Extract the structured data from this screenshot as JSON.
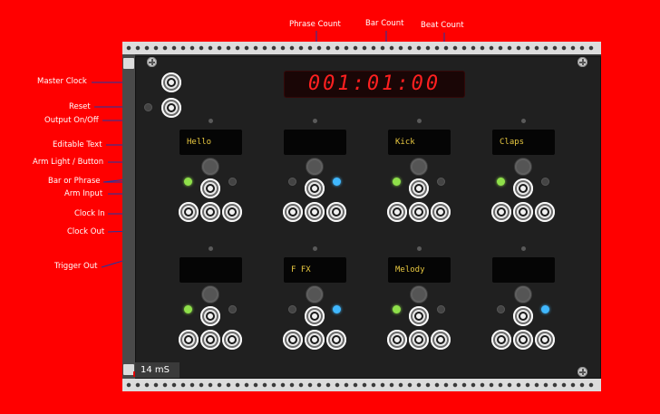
{
  "annotations": {
    "phrase_count": "Phrase Count",
    "bar_count": "Bar Count",
    "beat_count": "Beat Count",
    "master_clock": "Master Clock",
    "reset": "Reset",
    "output_on_off": "Output On/Off",
    "editable_text": "Editable Text",
    "arm_light_button": "Arm Light / Button",
    "bar_or_phrase": "Bar or Phrase",
    "arm_input": "Arm Input",
    "clock_in": "Clock In",
    "clock_out": "Clock Out",
    "trigger_out": "Trigger Out"
  },
  "counter_display": "001:01:00",
  "latency": "14 mS",
  "tracks": [
    {
      "text": "Hello",
      "bar_or_phrase_light": "green",
      "arm_light": "off"
    },
    {
      "text": "",
      "bar_or_phrase_light": "off",
      "arm_light": "blue"
    },
    {
      "text": "Kick",
      "bar_or_phrase_light": "green",
      "arm_light": "off"
    },
    {
      "text": "Claps",
      "bar_or_phrase_light": "green",
      "arm_light": "off"
    },
    {
      "text": "",
      "bar_or_phrase_light": "green",
      "arm_light": "off"
    },
    {
      "text": "F FX",
      "bar_or_phrase_light": "off",
      "arm_light": "blue"
    },
    {
      "text": "Melody",
      "bar_or_phrase_light": "green",
      "arm_light": "off"
    },
    {
      "text": "",
      "bar_or_phrase_light": "off",
      "arm_light": "blue"
    }
  ],
  "colors": {
    "background": "#ff0000",
    "display_text": "#e8c840",
    "led_digits": "#ff2020",
    "light_green": "#8fe04a",
    "light_blue": "#40b8ff"
  }
}
